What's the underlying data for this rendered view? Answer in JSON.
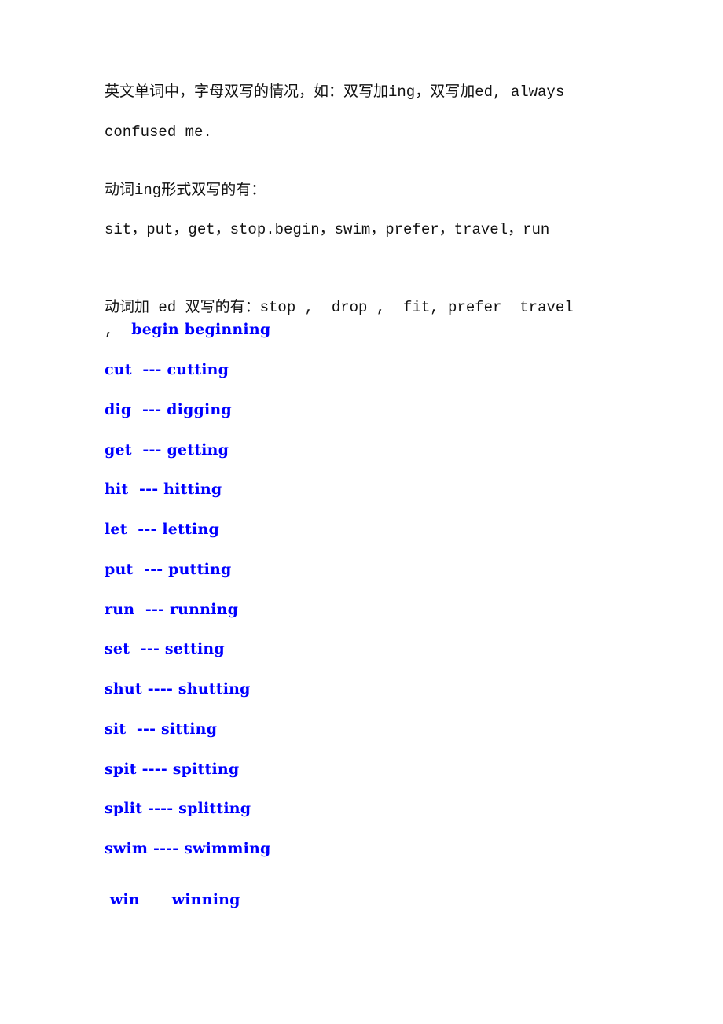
{
  "intro": {
    "line1": "英文单词中，字母双写的情况，如：双写加ing，双写加ed, always",
    "line2": "confused me."
  },
  "ing_section": {
    "heading": "动词ing形式双写的有：",
    "examples": "sit，put，get，stop.begin，swim，prefer，travel，run"
  },
  "ed_section": {
    "heading_line": "动词加 ed 双写的有：stop ,  drop ,  fit, prefer  travel",
    "second_line_prefix": ",  ",
    "second_line_blue": "begin beginning"
  },
  "pairs": [
    "cut  --- cutting",
    "dig  --- digging",
    "get  --- getting",
    "hit  --- hitting",
    "let  --- letting",
    "put  --- putting",
    "run  --- running",
    "set  --- setting",
    "shut ---- shutting",
    "sit  --- sitting",
    "spit ---- spitting",
    "split ---- splitting",
    "swim ---- swimming"
  ],
  "last_pair": " win      winning",
  "colors": {
    "text": "#111111",
    "highlight": "#0000ff",
    "background": "#ffffff"
  }
}
